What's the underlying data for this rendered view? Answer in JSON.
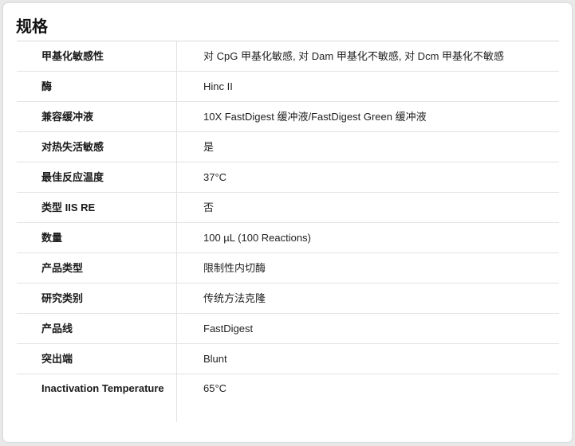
{
  "title": "规格",
  "specs": [
    {
      "label": "甲基化敏感性",
      "value": "对 CpG 甲基化敏感, 对 Dam 甲基化不敏感, 对 Dcm 甲基化不敏感"
    },
    {
      "label": "酶",
      "value": "Hinc II"
    },
    {
      "label": "兼容缓冲液",
      "value": "10X FastDigest 缓冲液/FastDigest Green 缓冲液"
    },
    {
      "label": "对热失活敏感",
      "value": "是"
    },
    {
      "label": "最佳反应温度",
      "value": "37°C"
    },
    {
      "label": "类型 IIS RE",
      "value": "否"
    },
    {
      "label": "数量",
      "value": "100 µL (100 Reactions)"
    },
    {
      "label": "产品类型",
      "value": "限制性内切酶"
    },
    {
      "label": "研究类别",
      "value": "传统方法克隆"
    },
    {
      "label": "产品线",
      "value": "FastDigest"
    },
    {
      "label": "突出端",
      "value": "Blunt"
    },
    {
      "label": "Inactivation Temperature",
      "value": "65°C"
    }
  ]
}
